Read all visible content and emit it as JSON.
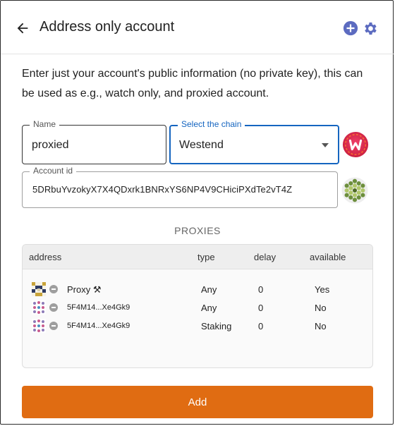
{
  "header": {
    "title": "Address only account"
  },
  "description": "Enter just your account's public information (no private key), this can be used as e.g., watch only, and proxied account.",
  "form": {
    "name_label": "Name",
    "name_value": "proxied",
    "chain_label": "Select the chain",
    "chain_value": "Westend",
    "account_label": "Account id",
    "account_value": "5DRbuYvzokyX7X4QDxrk1BNRxYS6NP4V9CHiciPXdTe2vT4Z"
  },
  "proxies": {
    "title": "PROXIES",
    "columns": [
      "address",
      "type",
      "delay",
      "available"
    ],
    "rows": [
      {
        "address": "Proxy ⚒",
        "type": "Any",
        "delay": "0",
        "available": "Yes"
      },
      {
        "address": "5F4M14...Xe4Gk9",
        "type": "Any",
        "delay": "0",
        "available": "No"
      },
      {
        "address": "5F4M14...Xe4Gk9",
        "type": "Staking",
        "delay": "0",
        "available": "No"
      }
    ]
  },
  "add_button": "Add",
  "colors": {
    "accent": "#e06c12",
    "focus": "#1565c0",
    "icon": "#5c6bc0"
  }
}
